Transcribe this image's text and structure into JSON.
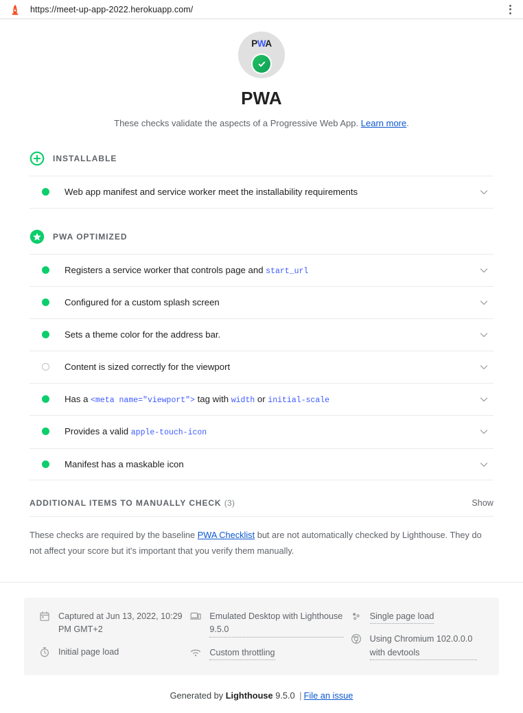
{
  "browser": {
    "url": "https://meet-up-app-2022.herokuapp.com/",
    "menu_icon": "kebab-menu-icon",
    "favicon": "lighthouse-favicon"
  },
  "report": {
    "gauge_logo": "PWA",
    "gauge_logo_p": "P",
    "gauge_logo_w": "W",
    "gauge_logo_a": "A",
    "category_title": "PWA",
    "category_desc_before": "These checks validate the aspects of a Progressive Web App. ",
    "category_desc_link": "Learn more",
    "category_desc_after": "."
  },
  "groups": [
    {
      "icon": "installable-plus-icon",
      "label": "INSTALLABLE",
      "audits": [
        {
          "status": "pass",
          "parts": [
            {
              "type": "text",
              "value": "Web app manifest and service worker meet the installability requirements"
            }
          ],
          "expand_icon": "chevron-down-icon"
        }
      ]
    },
    {
      "icon": "pwa-optimized-star-icon",
      "label": "PWA OPTIMIZED",
      "audits": [
        {
          "status": "pass",
          "parts": [
            {
              "type": "text",
              "value": "Registers a service worker that controls page and "
            },
            {
              "type": "code",
              "value": "start_url"
            }
          ],
          "expand_icon": "chevron-down-icon"
        },
        {
          "status": "pass",
          "parts": [
            {
              "type": "text",
              "value": "Configured for a custom splash screen"
            }
          ],
          "expand_icon": "chevron-down-icon"
        },
        {
          "status": "pass",
          "parts": [
            {
              "type": "text",
              "value": "Sets a theme color for the address bar."
            }
          ],
          "expand_icon": "chevron-down-icon"
        },
        {
          "status": "not-applicable",
          "parts": [
            {
              "type": "text",
              "value": "Content is sized correctly for the viewport"
            }
          ],
          "expand_icon": "chevron-down-icon"
        },
        {
          "status": "pass",
          "parts": [
            {
              "type": "text",
              "value": "Has a "
            },
            {
              "type": "code",
              "value": "<meta name=\"viewport\">"
            },
            {
              "type": "text",
              "value": " tag with "
            },
            {
              "type": "code",
              "value": "width"
            },
            {
              "type": "text",
              "value": " or "
            },
            {
              "type": "code",
              "value": "initial-scale"
            }
          ],
          "expand_icon": "chevron-down-icon"
        },
        {
          "status": "pass",
          "parts": [
            {
              "type": "text",
              "value": "Provides a valid "
            },
            {
              "type": "code",
              "value": "apple-touch-icon"
            }
          ],
          "expand_icon": "chevron-down-icon"
        },
        {
          "status": "pass",
          "parts": [
            {
              "type": "text",
              "value": "Manifest has a maskable icon"
            }
          ],
          "expand_icon": "chevron-down-icon"
        }
      ]
    }
  ],
  "manual": {
    "title": "ADDITIONAL ITEMS TO MANUALLY CHECK",
    "count": "(3)",
    "toggle_label": "Show",
    "desc_before": "These checks are required by the baseline ",
    "desc_link": "PWA Checklist",
    "desc_after": " but are not automatically checked by Lighthouse. They do not affect your score but it's important that you verify them manually."
  },
  "meta": {
    "columns": [
      {
        "items": [
          {
            "icon": "calendar-icon",
            "text": "Captured at Jun 13, 2022, 10:29 PM GMT+2",
            "tooltip": false
          },
          {
            "icon": "stopwatch-icon",
            "text": "Initial page load",
            "tooltip": false
          }
        ]
      },
      {
        "items": [
          {
            "icon": "devices-icon",
            "text": "Emulated Desktop with Lighthouse 9.5.0",
            "tooltip": true
          },
          {
            "icon": "network-throttle-icon",
            "text": "Custom throttling",
            "tooltip": true
          }
        ]
      },
      {
        "items": [
          {
            "icon": "single-page-load-icon",
            "text": "Single page load",
            "tooltip": true
          },
          {
            "icon": "chromium-icon",
            "text": "Using Chromium 102.0.0.0 with devtools",
            "tooltip": true
          }
        ]
      }
    ]
  },
  "footer": {
    "generated_by": "Generated by ",
    "brand": "Lighthouse",
    "version": " 9.5.0 ",
    "separator": "|",
    "issue_link": "File an issue"
  },
  "colors": {
    "pass_green": "#0cce6b",
    "na_gray": "#bdc1c6",
    "link_blue": "#0b57d0",
    "code_blue": "#3d5afe",
    "text_primary": "#212121",
    "text_secondary": "#5f6368",
    "meta_bg": "#f5f5f5"
  }
}
